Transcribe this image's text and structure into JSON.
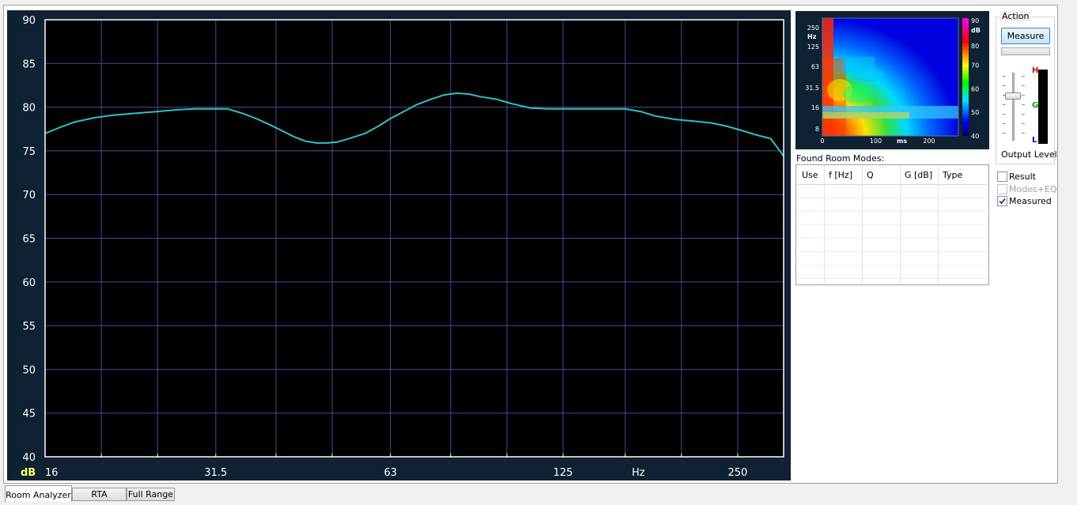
{
  "chart_data": {
    "type": "line",
    "ylabel": "dB",
    "xlabel": "Hz",
    "ylim": [
      40,
      90
    ],
    "y_ticks": [
      "90",
      "85",
      "80",
      "75",
      "70",
      "65",
      "60",
      "55",
      "50",
      "45",
      "40"
    ],
    "x_ticks": [
      "16",
      "31.5",
      "63",
      "125",
      "250"
    ],
    "x_scale": "log",
    "xlim": [
      16,
      300
    ],
    "grid": true,
    "colors": {
      "background": "#000000",
      "grid": "#4b4b96",
      "line": "#30c0c8",
      "axis_text": "#ffffff",
      "unit_text": "#ffff64"
    },
    "series": [
      {
        "x": [
          16,
          17,
          18,
          19.5,
          21,
          23,
          25,
          27,
          29,
          31,
          33,
          35,
          37,
          39,
          41,
          43,
          45,
          47,
          49,
          51,
          54,
          57,
          60,
          63,
          66,
          70,
          74,
          78,
          82,
          86,
          90,
          96,
          102,
          110,
          118,
          125,
          132,
          140,
          150,
          160,
          170,
          180,
          195,
          210,
          225,
          240,
          255,
          270,
          285,
          300
        ],
        "y": [
          77.0,
          77.7,
          78.3,
          78.8,
          79.1,
          79.3,
          79.5,
          79.7,
          79.8,
          79.8,
          79.8,
          79.3,
          78.7,
          78.0,
          77.3,
          76.6,
          76.1,
          75.9,
          75.9,
          76.0,
          76.5,
          77.0,
          77.8,
          78.7,
          79.4,
          80.3,
          80.9,
          81.4,
          81.6,
          81.5,
          81.2,
          80.9,
          80.4,
          79.9,
          79.8,
          79.8,
          79.8,
          79.8,
          79.8,
          79.8,
          79.5,
          79.0,
          78.6,
          78.4,
          78.2,
          77.8,
          77.3,
          76.8,
          76.4,
          74.4
        ]
      }
    ]
  },
  "waterfall": {
    "y_ticks": [
      "250",
      "125",
      "63",
      "31.5",
      "16",
      "8"
    ],
    "y_unit": "Hz",
    "x_ticks": [
      "0",
      "100",
      "200"
    ],
    "x_unit": "ms",
    "scale_ticks": [
      "90",
      "80",
      "70",
      "60",
      "50",
      "40"
    ],
    "scale_unit": "dB",
    "colorbar": [
      "#ff00ff",
      "#ff0000",
      "#ffff00",
      "#00ff00",
      "#00e0ff",
      "#0000ff",
      "#000060"
    ]
  },
  "room_modes": {
    "label": "Found Room Modes:",
    "columns": [
      "Use",
      "f [Hz]",
      "Q",
      "G [dB]",
      "Type"
    ],
    "rows": []
  },
  "action": {
    "title": "Action",
    "measure_label": "Measure",
    "output_level_label": "Output Level",
    "meter_labels": [
      "H",
      "G",
      "L"
    ]
  },
  "checkboxes": [
    {
      "label": "Result",
      "checked": false,
      "enabled": true
    },
    {
      "label": "Modes+EQ",
      "checked": false,
      "enabled": false
    },
    {
      "label": "Measured",
      "checked": true,
      "enabled": true
    }
  ],
  "tabs": [
    {
      "label": "Room Analyzer",
      "active": true
    },
    {
      "label": "RTA",
      "active": false
    },
    {
      "label": "Full Range",
      "active": false
    }
  ]
}
